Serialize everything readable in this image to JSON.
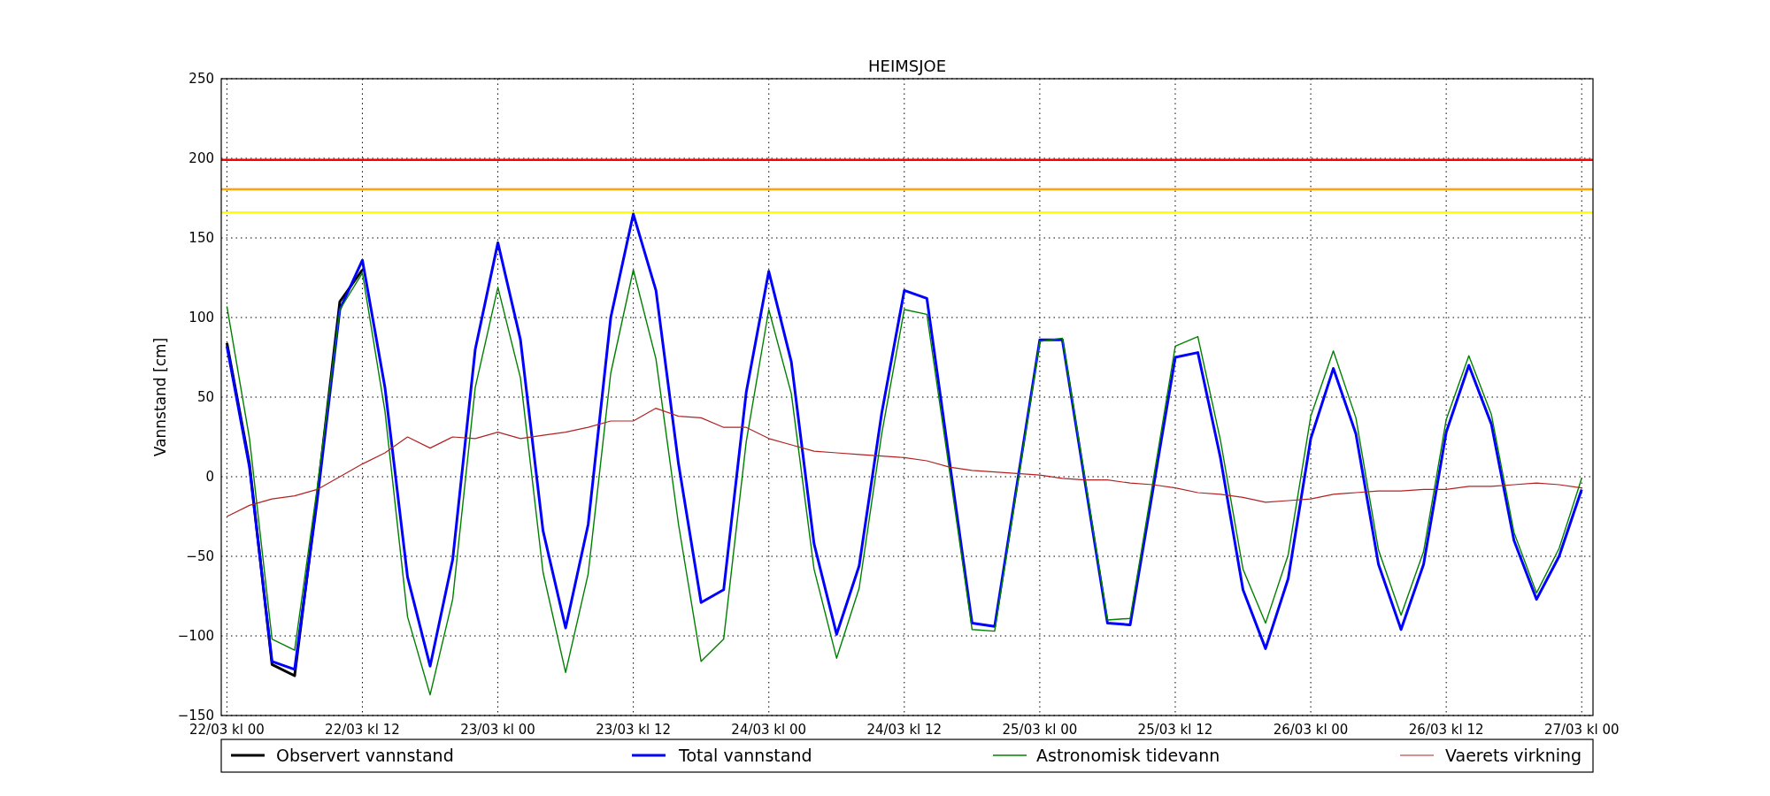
{
  "chart_data": {
    "type": "line",
    "title": "HEIMSJOE",
    "ylabel": "Vannstand [cm]",
    "categories": [
      "22/03 kl 00",
      null,
      null,
      null,
      null,
      null,
      "22/03 kl 12",
      null,
      null,
      null,
      null,
      null,
      "23/03 kl 00",
      null,
      null,
      null,
      null,
      null,
      "23/03 kl 12",
      null,
      null,
      null,
      null,
      null,
      "24/03 kl 00",
      null,
      null,
      null,
      null,
      null,
      "24/03 kl 12",
      null,
      null,
      null,
      null,
      null,
      "25/03 kl 00",
      null,
      null,
      null,
      null,
      null,
      "25/03 kl 12",
      null,
      null,
      null,
      null,
      null,
      "26/03 kl 00",
      null,
      null,
      null,
      null,
      null,
      "26/03 kl 12",
      null,
      null,
      null,
      null,
      null,
      "27/03 kl 00"
    ],
    "ylim": [
      -150,
      250
    ],
    "grid": true,
    "legend": "bottom",
    "yticks": [
      {
        "value": -150,
        "label": "−150"
      },
      {
        "value": -100,
        "label": "−100"
      },
      {
        "value": -50,
        "label": "−50"
      },
      {
        "value": 0,
        "label": "0"
      },
      {
        "value": 50,
        "label": "50"
      },
      {
        "value": 100,
        "label": "100"
      },
      {
        "value": 150,
        "label": "150"
      },
      {
        "value": 200,
        "label": "200"
      },
      {
        "value": 250,
        "label": "250"
      }
    ],
    "series": [
      {
        "name": "Observert vannstand",
        "color": "#000000",
        "values": [
          84,
          8,
          -118,
          -125,
          -12,
          110,
          130,
          null,
          null,
          null,
          null,
          null,
          null,
          null,
          null,
          null,
          null,
          null,
          null,
          null,
          null,
          null,
          null,
          null,
          null,
          null,
          null,
          null,
          null,
          null,
          null,
          null,
          null,
          null,
          null,
          null,
          null,
          null,
          null,
          null,
          null,
          null,
          null,
          null,
          null,
          null,
          null,
          null,
          null,
          null,
          null,
          null,
          null,
          null,
          null,
          null,
          null,
          null,
          null,
          null,
          null
        ]
      },
      {
        "name": "Total vannstand",
        "color": "#0000ff",
        "values": [
          82,
          6,
          -116,
          -121,
          -15,
          105,
          136,
          56,
          -63,
          -119,
          -52,
          80,
          147,
          86,
          -34,
          -95,
          -30,
          100,
          165,
          117,
          8,
          -79,
          -71,
          53,
          129,
          72,
          -42,
          -99,
          -56,
          40,
          117,
          112,
          10,
          -92,
          -94,
          -4,
          86,
          86,
          -3,
          -92,
          -93,
          -9,
          75,
          78,
          12,
          -71,
          -108,
          -64,
          24,
          68,
          27,
          -55,
          -96,
          -55,
          28,
          70,
          33,
          -40,
          -77,
          -50,
          -8
        ]
      },
      {
        "name": "Astronomisk tidevann",
        "color": "#008000",
        "values": [
          107,
          24,
          -102,
          -109,
          -7,
          105,
          128,
          41,
          -88,
          -137,
          -77,
          56,
          119,
          62,
          -60,
          -123,
          -61,
          65,
          130,
          74,
          -30,
          -116,
          -102,
          22,
          105,
          52,
          -58,
          -114,
          -70,
          27,
          105,
          102,
          4,
          -96,
          -97,
          -6,
          85,
          87,
          -1,
          -90,
          -89,
          -4,
          82,
          88,
          23,
          -58,
          -92,
          -49,
          38,
          79,
          37,
          -46,
          -87,
          -47,
          36,
          76,
          39,
          -35,
          -73,
          -45,
          -1
        ]
      },
      {
        "name": "Vaerets virkning",
        "color": "#b22222",
        "values": [
          -25,
          -18,
          -14,
          -12,
          -8,
          0,
          8,
          15,
          25,
          18,
          25,
          24,
          28,
          24,
          26,
          28,
          31,
          35,
          35,
          43,
          38,
          37,
          31,
          31,
          24,
          20,
          16,
          15,
          14,
          13,
          12,
          10,
          6,
          4,
          3,
          2,
          1,
          -1,
          -2,
          -2,
          -4,
          -5,
          -7,
          -10,
          -11,
          -13,
          -16,
          -15,
          -14,
          -11,
          -10,
          -9,
          -9,
          -8,
          -8,
          -6,
          -6,
          -5,
          -4,
          -5,
          -7
        ]
      }
    ],
    "ref_lines": [
      {
        "axis": "y",
        "value": 199,
        "color": "#ff0000"
      },
      {
        "axis": "y",
        "value": 180.5,
        "color": "#ffa500"
      },
      {
        "axis": "y",
        "value": 166,
        "color": "#ffff00"
      }
    ]
  }
}
